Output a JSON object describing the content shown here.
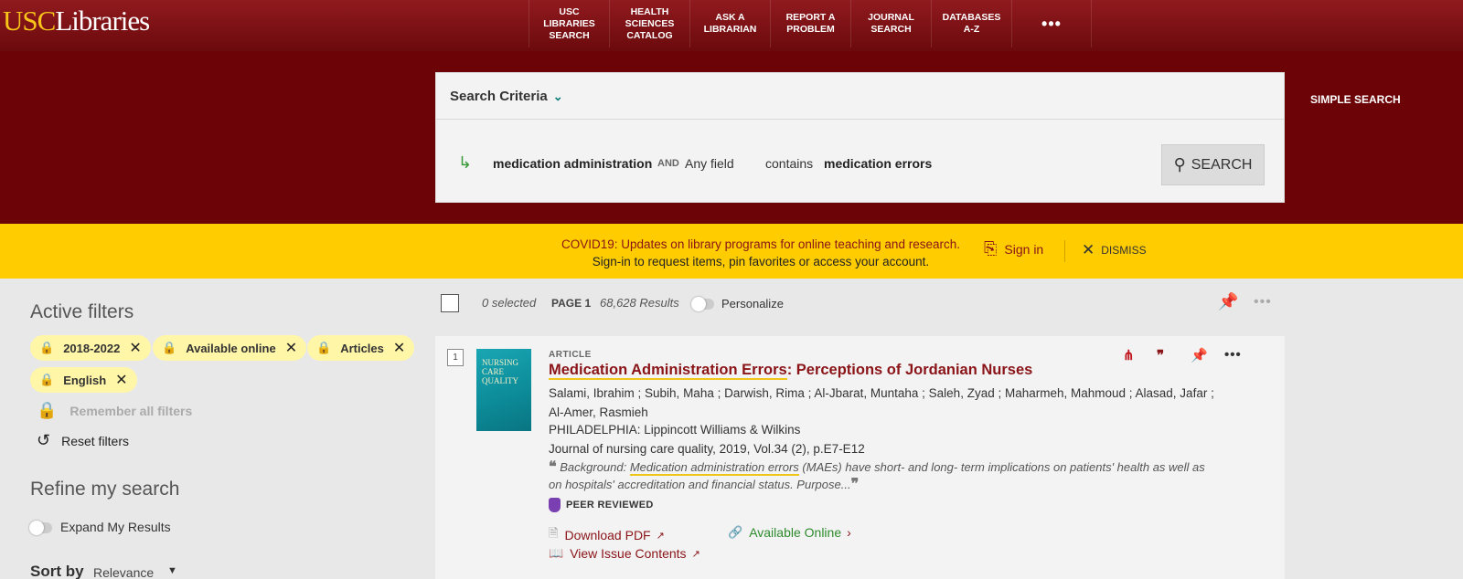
{
  "header": {
    "logo_usc": "USC",
    "logo_libraries": "Libraries",
    "nav": [
      {
        "line1": "USC",
        "line2": "LIBRARIES",
        "line3": "SEARCH"
      },
      {
        "line1": "HEALTH",
        "line2": "SCIENCES",
        "line3": "CATALOG"
      },
      {
        "line1": "ASK A",
        "line2": "LIBRARIAN",
        "line3": ""
      },
      {
        "line1": "REPORT A",
        "line2": "PROBLEM",
        "line3": ""
      },
      {
        "line1": "JOURNAL",
        "line2": "SEARCH",
        "line3": ""
      },
      {
        "line1": "DATABASES",
        "line2": "A-Z",
        "line3": ""
      }
    ],
    "more": "•••"
  },
  "search": {
    "criteria_label": "Search Criteria",
    "term1": "medication administration",
    "operator": "AND",
    "field": "Any field",
    "match": "contains",
    "term2": "medication errors",
    "button": "SEARCH",
    "simple_search": "SIMPLE SEARCH"
  },
  "banner": {
    "line1": "COVID19: Updates on library programs for online teaching and research.",
    "line2": "Sign-in to request items, pin favorites or access your account.",
    "sign_in": "Sign in",
    "dismiss": "DISMISS"
  },
  "filters": {
    "heading": "Active filters",
    "chips": [
      "2018-2022",
      "Available online",
      "Articles",
      "English"
    ],
    "remember": "Remember all filters",
    "reset": "Reset filters"
  },
  "refine": {
    "heading": "Refine my search",
    "expand": "Expand My Results",
    "sort_label": "Sort by",
    "sort_value": "Relevance"
  },
  "results": {
    "selected": "0 selected",
    "page": "PAGE 1",
    "count": "68,628 Results",
    "personalize": "Personalize"
  },
  "item": {
    "index": "1",
    "type": "ARTICLE",
    "title_hl": "Medication Administration Errors",
    "title_rest": ": Perceptions of Jordanian Nurses",
    "authors": "Salami, Ibrahim ; Subih, Maha ; Darwish, Rima ; Al-Jbarat, Muntaha ; Saleh, Zyad ; Maharmeh, Mahmoud ; Alasad, Jafar ; Al-Amer, Rasmieh",
    "publisher": "PHILADELPHIA: Lippincott Williams & Wilkins",
    "journal": "Journal of nursing care quality, 2019, Vol.34 (2), p.E7-E12",
    "snippet_pre": "Background: ",
    "snippet_hl": "Medication administration errors",
    "snippet_post": " (MAEs) have short- and long- term implications on patients' health as well as on hospitals' accreditation and financial status. Purpose...",
    "peer": "PEER REVIEWED",
    "download": "Download PDF",
    "available": "Available Online",
    "view_issue": "View Issue Contents",
    "cover_title": "NURSING CARE QUALITY"
  },
  "colors": {
    "brand_cardinal": "#8a1418",
    "brand_gold": "#f8c41a",
    "banner": "#ffcc00",
    "available_green": "#2e8b2e"
  }
}
